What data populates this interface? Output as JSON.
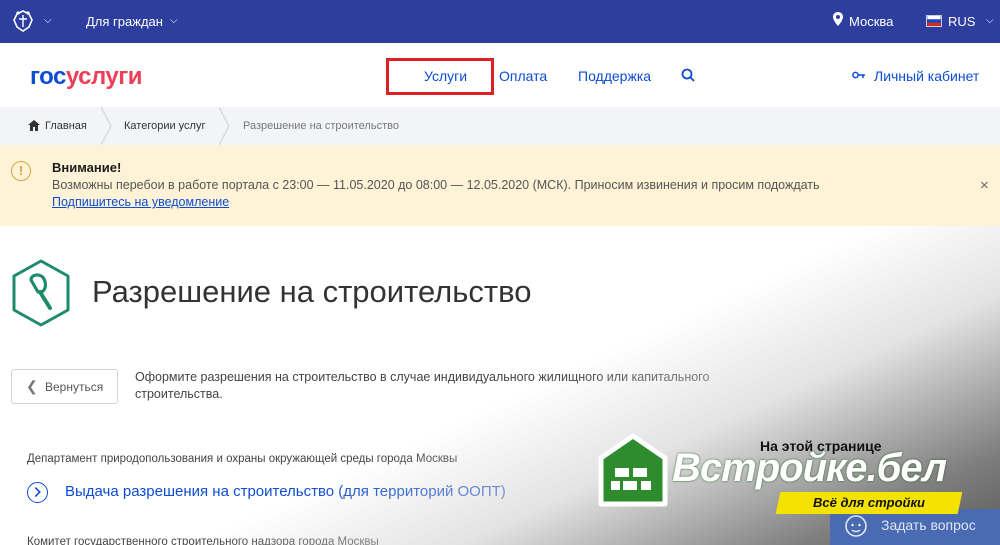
{
  "topbar": {
    "for_citizens": "Для граждан",
    "city": "Москва",
    "language": "RUS"
  },
  "header": {
    "logo_gos": "гос",
    "logo_uslugi": "услуги",
    "nav": {
      "services": "Услуги",
      "payment": "Оплата",
      "support": "Поддержка"
    },
    "cabinet": "Личный кабинет"
  },
  "breadcrumbs": {
    "home": "Главная",
    "categories": "Категории услуг",
    "current": "Разрешение на строительство"
  },
  "alert": {
    "title": "Внимание!",
    "text": "Возможны перебои в работе портала с 23:00 — 11.05.2020 до 08:00 — 12.05.2020 (МСК). Приносим извинения и просим подождать",
    "link": "Подпишитесь на уведомление",
    "icon_glyph": "!",
    "close_glyph": "×"
  },
  "main": {
    "title": "Разрешение на строительство",
    "back_label": "Вернуться",
    "description": "Оформите разрешения на строительство в случае индивидуального жилищного или капитального строительства.",
    "dept1": "Департамент природопользования и охраны окружающей среды города Москвы",
    "service1": "Выдача разрешения на строительство (для территорий ООПТ)",
    "dept2": "Комитет государственного строительного надзора города Москвы"
  },
  "side": {
    "on_page": "На этой странице",
    "ask_question": "Задать вопрос"
  },
  "watermark": {
    "brand": "Встройке.бел",
    "tagline": "Всё для стройки"
  },
  "colors": {
    "topbar": "#2d3e9f",
    "link_blue": "#0d4cd3",
    "logo_red": "#ee3f58",
    "alert_bg": "#fef3d7",
    "highlight_box": "#e02020",
    "icon_green": "#1e8a6e",
    "watermark_green": "#2e8b2e",
    "watermark_yellow": "#f4e300"
  },
  "icons": {
    "emblem": "coat-of-arms-icon",
    "pin": "map-pin-icon",
    "flag": "russian-flag-icon",
    "search": "search-icon",
    "key": "key-icon",
    "home": "home-icon",
    "warning": "warning-icon",
    "close": "close-icon",
    "service": "trowel-icon",
    "back": "chevron-left-icon",
    "link": "chevron-right-circle-icon",
    "chat": "chat-bubble-icon"
  }
}
